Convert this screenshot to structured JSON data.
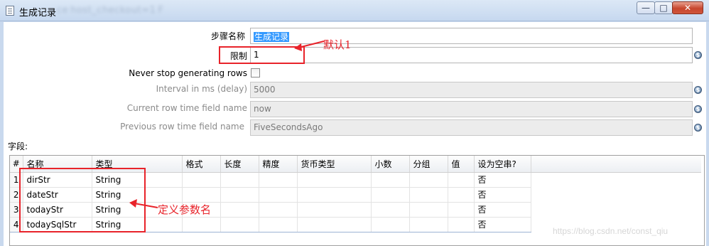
{
  "window": {
    "title": "生成记录",
    "title_suffix": "ce host_checkout=1 F",
    "minimize_glyph": "—",
    "maximize_glyph": "□",
    "close_glyph": "✕"
  },
  "form": {
    "step_name_label": "步骤名称",
    "step_name_value": "生成记录",
    "limit_label": "限制",
    "limit_value": "1",
    "never_stop_label": "Never stop generating rows",
    "never_stop_checked": false,
    "interval_label": "Interval in ms (delay)",
    "interval_value": "5000",
    "current_field_label": "Current row time field name",
    "current_field_value": "now",
    "previous_field_label": "Previous row time field name",
    "previous_field_value": "FiveSecondsAgo",
    "variable_icon_glyph": "$"
  },
  "fields": {
    "section_label": "字段:",
    "columns": [
      "#",
      "名称",
      "类型",
      "格式",
      "长度",
      "精度",
      "货币类型",
      "小数",
      "分组",
      "值",
      "设为空串?"
    ],
    "rows": [
      {
        "num": "1",
        "name": "dirStr",
        "type": "String",
        "empty": "否"
      },
      {
        "num": "2",
        "name": "dateStr",
        "type": "String",
        "empty": "否"
      },
      {
        "num": "3",
        "name": "todayStr",
        "type": "String",
        "empty": "否"
      },
      {
        "num": "4",
        "name": "todaySqlStr",
        "type": "String",
        "empty": "否"
      }
    ]
  },
  "annotations": {
    "default_note": "默认1",
    "params_note": "定义参数名",
    "color": "#e8232a"
  },
  "watermark": "https://blog.csdn.net/const_qiu"
}
